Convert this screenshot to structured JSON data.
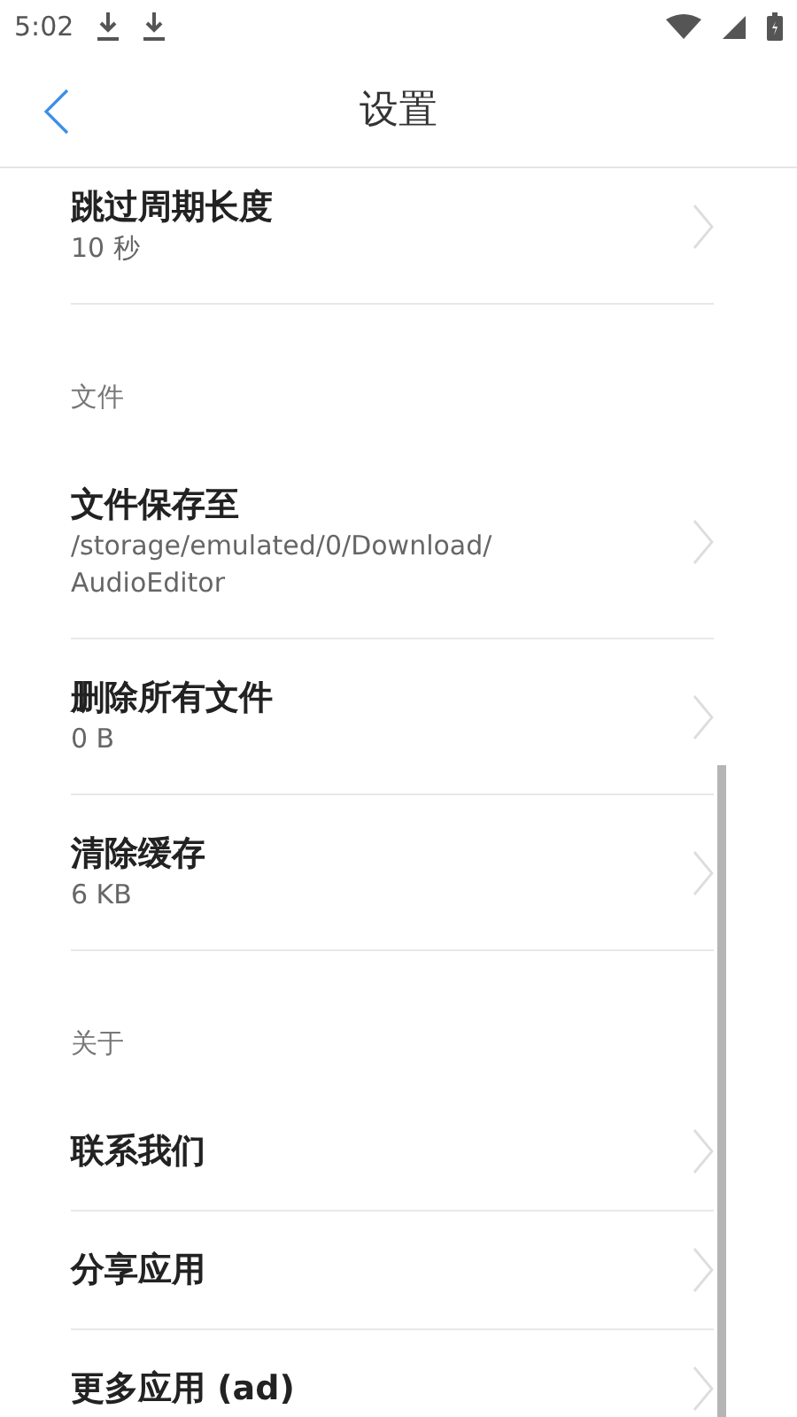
{
  "status_bar": {
    "time": "5:02"
  },
  "header": {
    "title": "设置"
  },
  "sections": [
    {
      "items": [
        {
          "title": "跳过周期长度",
          "subtitle": "10 秒"
        }
      ]
    },
    {
      "header": "文件",
      "items": [
        {
          "title": "文件保存至",
          "subtitle": "/storage/emulated/0/Download/AudioEditor"
        },
        {
          "title": "删除所有文件",
          "subtitle": "0 B"
        },
        {
          "title": "清除缓存",
          "subtitle": "6 KB"
        }
      ]
    },
    {
      "header": "关于",
      "items": [
        {
          "title": "联系我们"
        },
        {
          "title": "分享应用"
        },
        {
          "title": "更多应用 (ad)"
        }
      ]
    }
  ]
}
